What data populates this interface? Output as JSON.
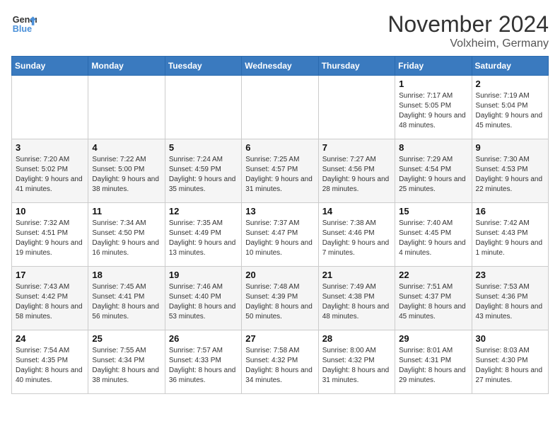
{
  "logo": {
    "line1": "General",
    "line2": "Blue"
  },
  "title": "November 2024",
  "location": "Volxheim, Germany",
  "weekdays": [
    "Sunday",
    "Monday",
    "Tuesday",
    "Wednesday",
    "Thursday",
    "Friday",
    "Saturday"
  ],
  "weeks": [
    [
      {
        "day": "",
        "info": ""
      },
      {
        "day": "",
        "info": ""
      },
      {
        "day": "",
        "info": ""
      },
      {
        "day": "",
        "info": ""
      },
      {
        "day": "",
        "info": ""
      },
      {
        "day": "1",
        "info": "Sunrise: 7:17 AM\nSunset: 5:05 PM\nDaylight: 9 hours and 48 minutes."
      },
      {
        "day": "2",
        "info": "Sunrise: 7:19 AM\nSunset: 5:04 PM\nDaylight: 9 hours and 45 minutes."
      }
    ],
    [
      {
        "day": "3",
        "info": "Sunrise: 7:20 AM\nSunset: 5:02 PM\nDaylight: 9 hours and 41 minutes."
      },
      {
        "day": "4",
        "info": "Sunrise: 7:22 AM\nSunset: 5:00 PM\nDaylight: 9 hours and 38 minutes."
      },
      {
        "day": "5",
        "info": "Sunrise: 7:24 AM\nSunset: 4:59 PM\nDaylight: 9 hours and 35 minutes."
      },
      {
        "day": "6",
        "info": "Sunrise: 7:25 AM\nSunset: 4:57 PM\nDaylight: 9 hours and 31 minutes."
      },
      {
        "day": "7",
        "info": "Sunrise: 7:27 AM\nSunset: 4:56 PM\nDaylight: 9 hours and 28 minutes."
      },
      {
        "day": "8",
        "info": "Sunrise: 7:29 AM\nSunset: 4:54 PM\nDaylight: 9 hours and 25 minutes."
      },
      {
        "day": "9",
        "info": "Sunrise: 7:30 AM\nSunset: 4:53 PM\nDaylight: 9 hours and 22 minutes."
      }
    ],
    [
      {
        "day": "10",
        "info": "Sunrise: 7:32 AM\nSunset: 4:51 PM\nDaylight: 9 hours and 19 minutes."
      },
      {
        "day": "11",
        "info": "Sunrise: 7:34 AM\nSunset: 4:50 PM\nDaylight: 9 hours and 16 minutes."
      },
      {
        "day": "12",
        "info": "Sunrise: 7:35 AM\nSunset: 4:49 PM\nDaylight: 9 hours and 13 minutes."
      },
      {
        "day": "13",
        "info": "Sunrise: 7:37 AM\nSunset: 4:47 PM\nDaylight: 9 hours and 10 minutes."
      },
      {
        "day": "14",
        "info": "Sunrise: 7:38 AM\nSunset: 4:46 PM\nDaylight: 9 hours and 7 minutes."
      },
      {
        "day": "15",
        "info": "Sunrise: 7:40 AM\nSunset: 4:45 PM\nDaylight: 9 hours and 4 minutes."
      },
      {
        "day": "16",
        "info": "Sunrise: 7:42 AM\nSunset: 4:43 PM\nDaylight: 9 hours and 1 minute."
      }
    ],
    [
      {
        "day": "17",
        "info": "Sunrise: 7:43 AM\nSunset: 4:42 PM\nDaylight: 8 hours and 58 minutes."
      },
      {
        "day": "18",
        "info": "Sunrise: 7:45 AM\nSunset: 4:41 PM\nDaylight: 8 hours and 56 minutes."
      },
      {
        "day": "19",
        "info": "Sunrise: 7:46 AM\nSunset: 4:40 PM\nDaylight: 8 hours and 53 minutes."
      },
      {
        "day": "20",
        "info": "Sunrise: 7:48 AM\nSunset: 4:39 PM\nDaylight: 8 hours and 50 minutes."
      },
      {
        "day": "21",
        "info": "Sunrise: 7:49 AM\nSunset: 4:38 PM\nDaylight: 8 hours and 48 minutes."
      },
      {
        "day": "22",
        "info": "Sunrise: 7:51 AM\nSunset: 4:37 PM\nDaylight: 8 hours and 45 minutes."
      },
      {
        "day": "23",
        "info": "Sunrise: 7:53 AM\nSunset: 4:36 PM\nDaylight: 8 hours and 43 minutes."
      }
    ],
    [
      {
        "day": "24",
        "info": "Sunrise: 7:54 AM\nSunset: 4:35 PM\nDaylight: 8 hours and 40 minutes."
      },
      {
        "day": "25",
        "info": "Sunrise: 7:55 AM\nSunset: 4:34 PM\nDaylight: 8 hours and 38 minutes."
      },
      {
        "day": "26",
        "info": "Sunrise: 7:57 AM\nSunset: 4:33 PM\nDaylight: 8 hours and 36 minutes."
      },
      {
        "day": "27",
        "info": "Sunrise: 7:58 AM\nSunset: 4:32 PM\nDaylight: 8 hours and 34 minutes."
      },
      {
        "day": "28",
        "info": "Sunrise: 8:00 AM\nSunset: 4:32 PM\nDaylight: 8 hours and 31 minutes."
      },
      {
        "day": "29",
        "info": "Sunrise: 8:01 AM\nSunset: 4:31 PM\nDaylight: 8 hours and 29 minutes."
      },
      {
        "day": "30",
        "info": "Sunrise: 8:03 AM\nSunset: 4:30 PM\nDaylight: 8 hours and 27 minutes."
      }
    ]
  ]
}
